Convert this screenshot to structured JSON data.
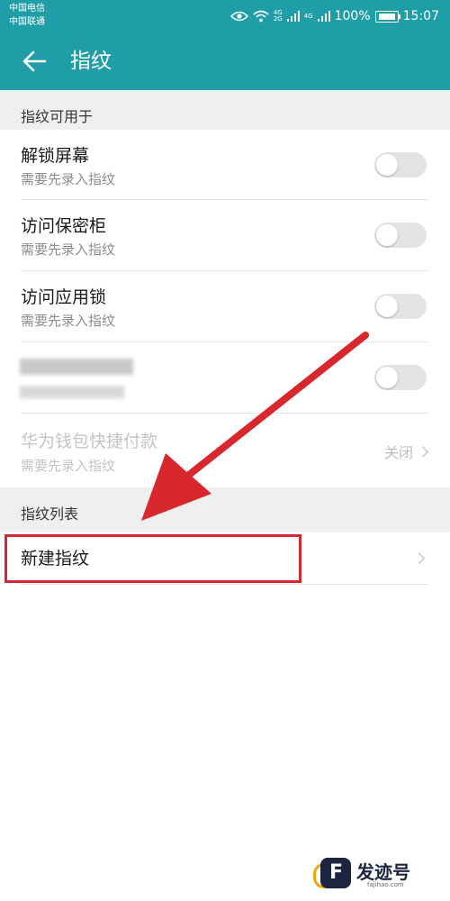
{
  "status_bar": {
    "carrier_1": "中国电信",
    "carrier_2": "中国联通",
    "battery_text": "100%",
    "time": "15:07",
    "net_a": "4G",
    "net_b": "2G",
    "net_c": "4G"
  },
  "app_bar": {
    "title": "指纹",
    "back_icon": "arrow-left-icon"
  },
  "sections": {
    "usage_header": "指纹可用于",
    "list_header": "指纹列表"
  },
  "usage_items": [
    {
      "title": "解锁屏幕",
      "subtitle": "需要先录入指纹",
      "enabled": false
    },
    {
      "title": "访问保密柜",
      "subtitle": "需要先录入指纹",
      "enabled": false
    },
    {
      "title": "访问应用锁",
      "subtitle": "需要先录入指纹",
      "enabled": false
    },
    {
      "title": "",
      "subtitle": "",
      "enabled": false
    },
    {
      "title": "华为钱包快捷付款",
      "subtitle": "需要先录入指纹",
      "value": "关闭"
    }
  ],
  "fingerprint_list": {
    "new_fingerprint_label": "新建指纹"
  },
  "watermark": {
    "brand": "发迹号",
    "domain": "fajihao.com"
  },
  "colors": {
    "header_teal": "#1f9ea8",
    "annotation_red": "#d8272d"
  }
}
